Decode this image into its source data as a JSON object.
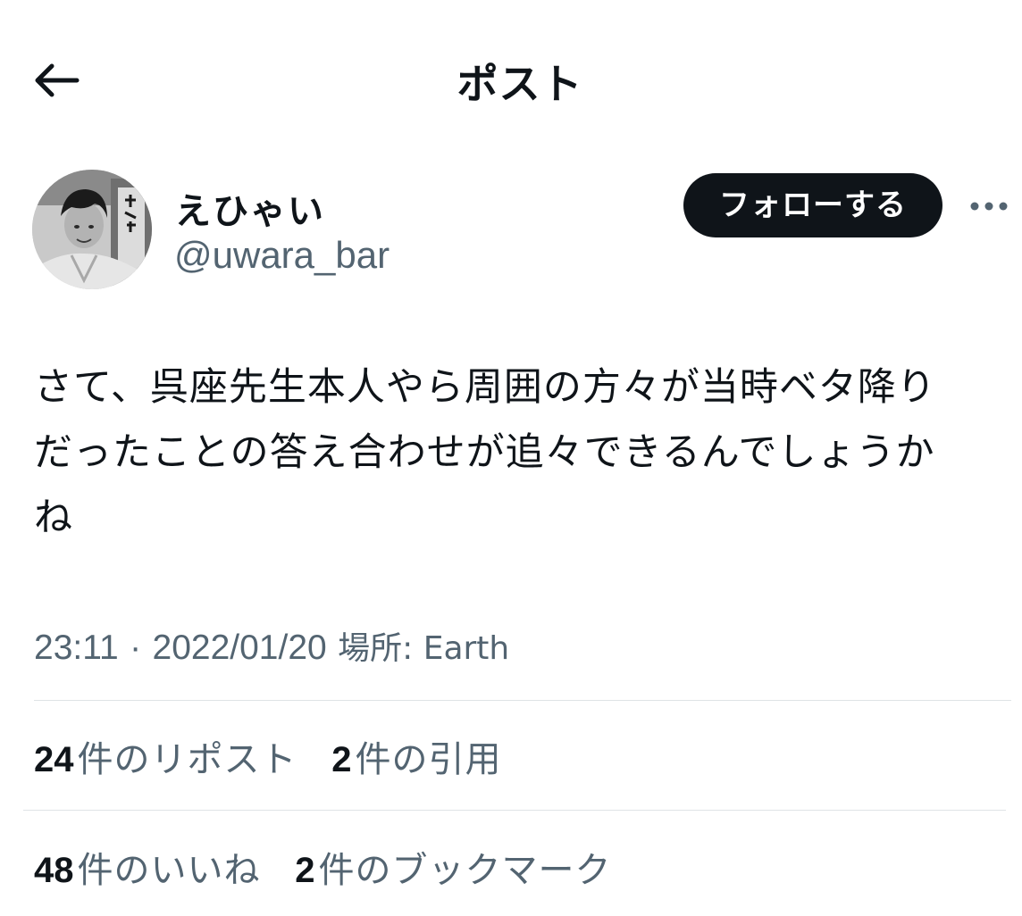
{
  "header": {
    "back_icon": "arrow-left-icon",
    "title": "ポスト"
  },
  "author": {
    "display_name": "えひゃい",
    "handle": "@uwara_bar",
    "avatar_icon": "avatar-photo-icon"
  },
  "actions": {
    "follow_label": "フォローする",
    "more_icon": "more-horizontal-icon"
  },
  "tweet": {
    "lines": [
      "さて、呉座先生本人やら周囲の方々が当時ベタ降り",
      "だったことの答え合わせが追々できるんでしょうか",
      "ね"
    ],
    "time": "23:11",
    "separator": "·",
    "date": "2022/01/20",
    "location": "場所: Earth"
  },
  "stats": {
    "reposts_count": "24",
    "reposts_label": "件のリポスト",
    "quotes_count": "2",
    "quotes_label": "件の引用",
    "likes_count": "48",
    "likes_label": "件のいいね",
    "bookmarks_count": "2",
    "bookmarks_label": "件のブックマーク"
  },
  "colors": {
    "text_primary": "#0f1419",
    "text_secondary": "#536471",
    "follow_button_bg": "#0f1419",
    "divider": "#dfe3e6"
  }
}
